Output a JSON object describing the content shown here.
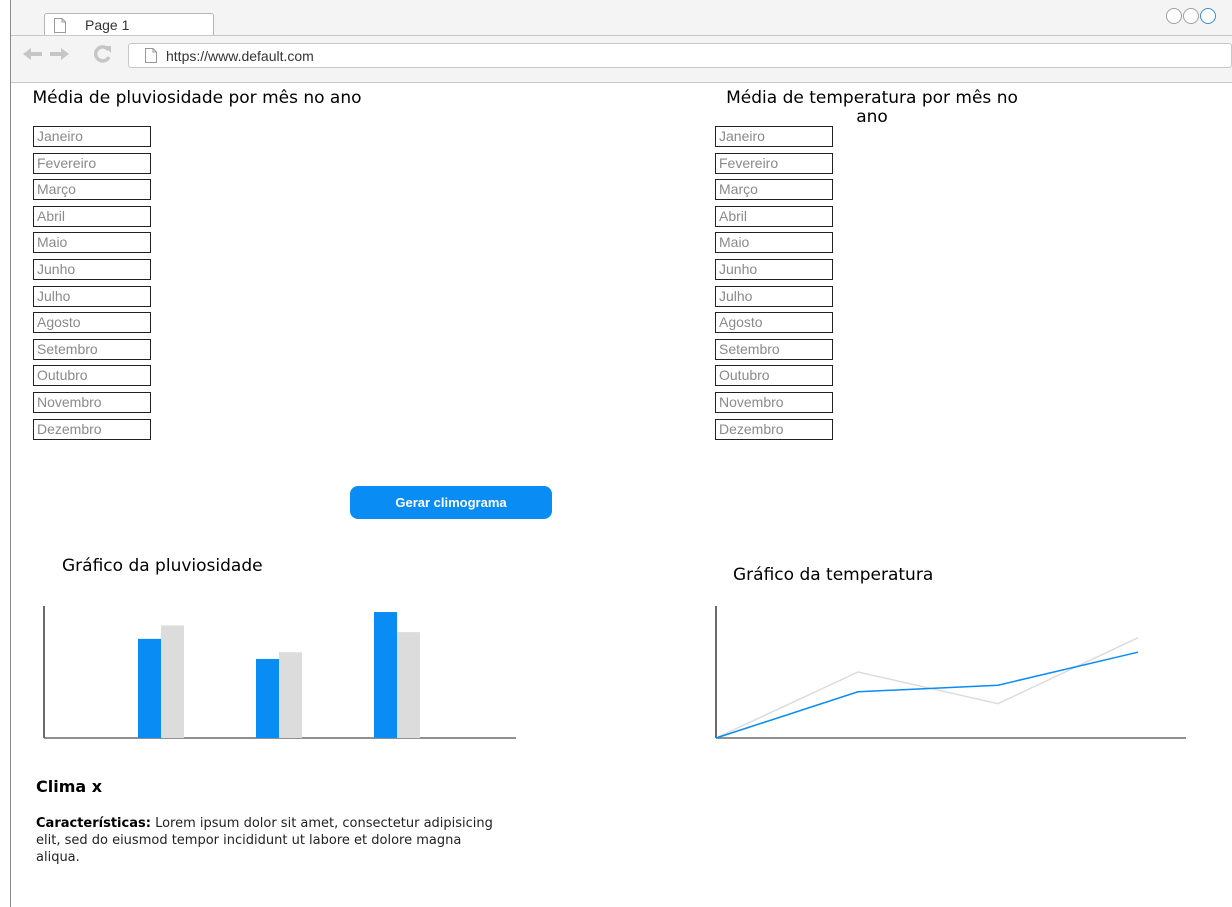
{
  "browser": {
    "tab_title": "Page 1",
    "url": "https://www.default.com"
  },
  "pluviosidade": {
    "title": "Média de pluviosidade por mês no ano",
    "months": [
      "Janeiro",
      "Fevereiro",
      "Março",
      "Abril",
      "Maio",
      "Junho",
      "Julho",
      "Agosto",
      "Setembro",
      "Outubro",
      "Novembro",
      "Dezembro"
    ]
  },
  "temperatura": {
    "title": "Média de temperatura por mês no ano",
    "months": [
      "Janeiro",
      "Fevereiro",
      "Março",
      "Abril",
      "Maio",
      "Junho",
      "Julho",
      "Agosto",
      "Setembro",
      "Outubro",
      "Novembro",
      "Dezembro"
    ]
  },
  "button": {
    "label": "Gerar climograma"
  },
  "charts_titles": {
    "pluviosidade": "Gráfico da pluviosidade",
    "temperatura": "Gráfico da temperatura"
  },
  "chart_data": [
    {
      "type": "bar",
      "title": "Gráfico da pluviosidade",
      "categories": [
        "",
        "",
        ""
      ],
      "series": [
        {
          "values": [
            74,
            59,
            94
          ],
          "color": "#0a8cf5"
        },
        {
          "values": [
            84,
            64,
            79
          ],
          "color": "#dcdcdc"
        }
      ],
      "ylim": [
        0,
        100
      ]
    },
    {
      "type": "line",
      "title": "Gráfico da temperatura",
      "x": [
        0,
        1,
        2,
        3
      ],
      "series": [
        {
          "values": [
            0,
            35,
            40,
            65
          ],
          "color": "#0a8cf5"
        },
        {
          "values": [
            0,
            50,
            26,
            76
          ],
          "color": "#dcdcdc"
        }
      ],
      "ylim": [
        0,
        100
      ]
    }
  ],
  "clima": {
    "title": "Clima x",
    "label": "Características:",
    "text": " Lorem ipsum dolor sit amet, consectetur adipisicing elit, sed do eiusmod tempor incididunt ut labore et dolore magna aliqua."
  },
  "colors": {
    "accent": "#0a8cf5",
    "secondary": "#dcdcdc"
  }
}
